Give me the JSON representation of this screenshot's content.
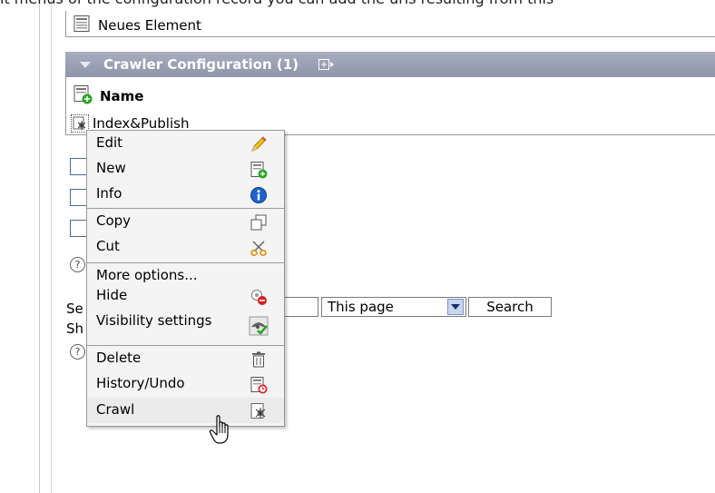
{
  "top_partial_text": "it menus of the configuration record you can add the urls resulting from this",
  "record_list": {
    "new_element_label": "Neues Element",
    "crawler_section_title": "Crawler Configuration (1)",
    "column_name_label": "Name",
    "record_title": "Index&Publish"
  },
  "form": {
    "search_label_partial": "Se",
    "show_label_partial": "Sh",
    "help_glyph": "?",
    "scope_selected": "This page",
    "search_button_label": "Search"
  },
  "context_menu": {
    "items": [
      {
        "label": "Edit",
        "icon": "pencil-icon"
      },
      {
        "label": "New",
        "icon": "new-record-icon"
      },
      {
        "label": "Info",
        "icon": "info-icon"
      },
      {
        "label": "Copy",
        "icon": "copy-icon"
      },
      {
        "label": "Cut",
        "icon": "scissors-icon"
      },
      {
        "label": "More options...",
        "icon": ""
      },
      {
        "label": "Hide",
        "icon": "hide-icon"
      },
      {
        "label": "Visibility settings",
        "icon": "visibility-icon"
      },
      {
        "label": "Delete",
        "icon": "trash-icon"
      },
      {
        "label": "History/Undo",
        "icon": "history-icon"
      },
      {
        "label": "Crawl",
        "icon": "crawl-icon"
      }
    ],
    "hovered_item": "Crawl"
  },
  "colors": {
    "section_header_bg": "#969cb0",
    "menu_bg": "#f4f4f4",
    "menu_border": "#9a9a9a",
    "checkbox_border": "#4a6a9a",
    "accent_blue": "#1e64c8",
    "accent_red": "#d42020",
    "accent_green": "#2aa52a"
  }
}
